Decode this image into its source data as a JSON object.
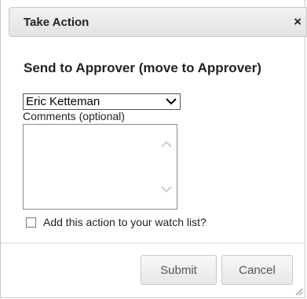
{
  "dialog": {
    "title": "Take Action",
    "close_symbol": "×",
    "heading": "Send to Approver (move to Approver)",
    "approver_select": {
      "selected": "Eric Ketteman"
    },
    "comments_label": "Comments (optional)",
    "comments_value": "",
    "watch_list_label": "Add this action to your watch list?",
    "watch_list_checked": false,
    "buttons": {
      "submit": "Submit",
      "cancel": "Cancel"
    }
  },
  "icons": {
    "close": "close-icon",
    "select_arrow": "chevron-down-icon",
    "scroll_up": "chevron-up-icon",
    "scroll_down": "chevron-down-icon",
    "resize": "resize-grip-icon"
  },
  "colors": {
    "titlebar": "#e9e9e9",
    "text": "#222222",
    "button_text": "#555555"
  }
}
